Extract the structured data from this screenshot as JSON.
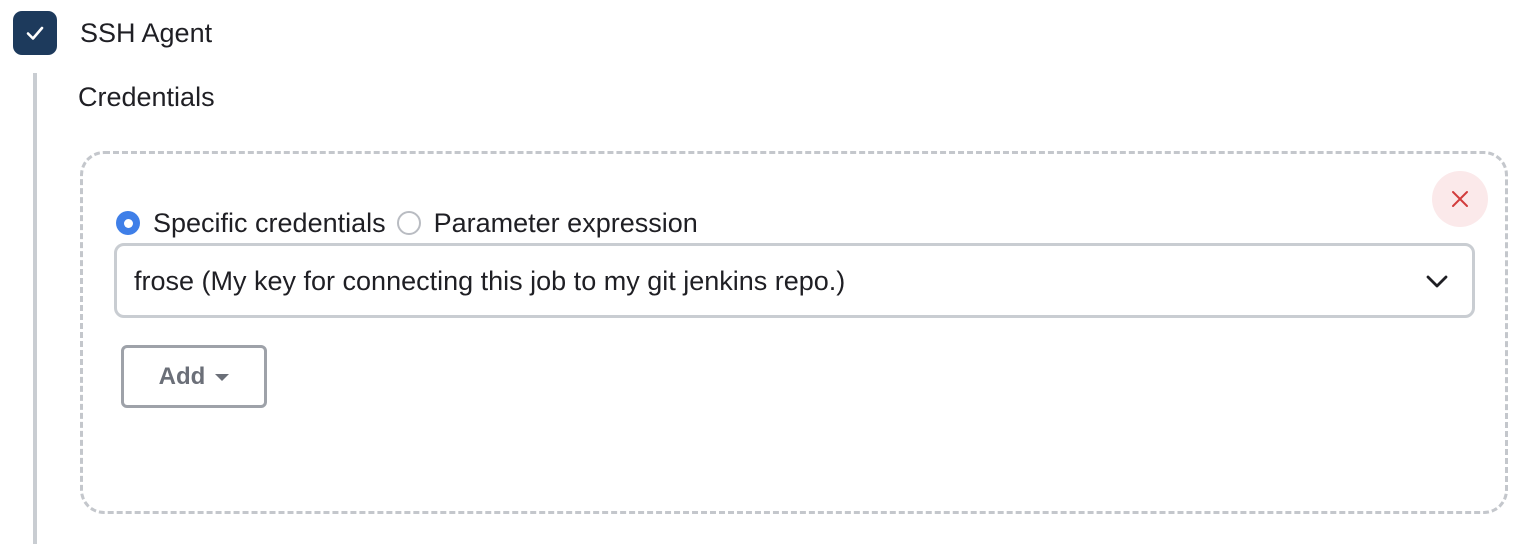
{
  "ssh_agent": {
    "checked": true,
    "label": "SSH Agent",
    "icon": "check-icon",
    "checkbox_color": "#1d3a5c"
  },
  "credentials": {
    "section_label": "Credentials",
    "radio_options": [
      {
        "label": "Specific credentials",
        "selected": true
      },
      {
        "label": "Parameter expression",
        "selected": false
      }
    ],
    "select_value": "frose (My key for connecting this job to my git jenkins repo.)",
    "select_icon": "chevron-down-icon",
    "add_button_label": "Add",
    "add_button_icon": "caret-down-icon",
    "delete_icon": "close-icon",
    "delete_color": "#d23c3c",
    "radio_accent_color": "#3f7fe8"
  }
}
